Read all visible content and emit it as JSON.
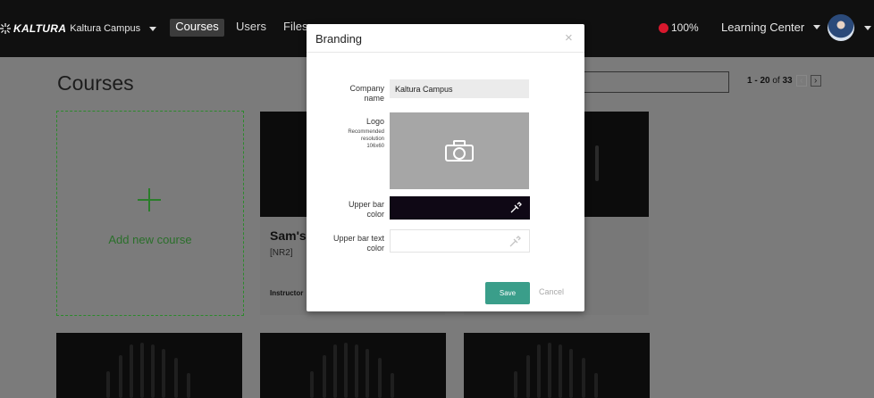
{
  "topbar": {
    "brand_name": "KALTURA",
    "brand_sub": "Kaltura Campus",
    "nav": [
      {
        "label": "Courses",
        "active": true
      },
      {
        "label": "Users"
      },
      {
        "label": "Files"
      }
    ],
    "status_percent": "100%",
    "account_label": "Learning Center"
  },
  "page": {
    "title": "Courses",
    "pager_range": "1 - 20",
    "pager_of": " of ",
    "pager_total": "33",
    "add_course_label": "Add new course",
    "course_title": "Sam's",
    "course_code": "[NR2]",
    "course_instructor": "Instructor"
  },
  "modal": {
    "title": "Branding",
    "close": "×",
    "company_label": "Company name",
    "company_value": "Kaltura Campus",
    "logo_label": "Logo",
    "logo_hint": "Recommended resolution 106x60",
    "upper_bar_label": "Upper bar color",
    "upper_bar_color": "#0f0815",
    "upper_bar_text_label": "Upper bar text color",
    "upper_bar_text_color": "#ffffff",
    "save_label": "Save",
    "cancel_label": "Cancel"
  },
  "colors": {
    "accent": "#3a9e8a",
    "add_green": "#2a7d2a",
    "status_red": "#d8182d",
    "topbar": "#101010"
  },
  "icons": [
    "kaltura-logo-icon",
    "chevron-down-icon",
    "status-dot-icon",
    "avatar",
    "close-icon",
    "camera-icon",
    "eyedropper-icon",
    "chevron-left-icon",
    "chevron-right-icon",
    "plus-icon"
  ]
}
